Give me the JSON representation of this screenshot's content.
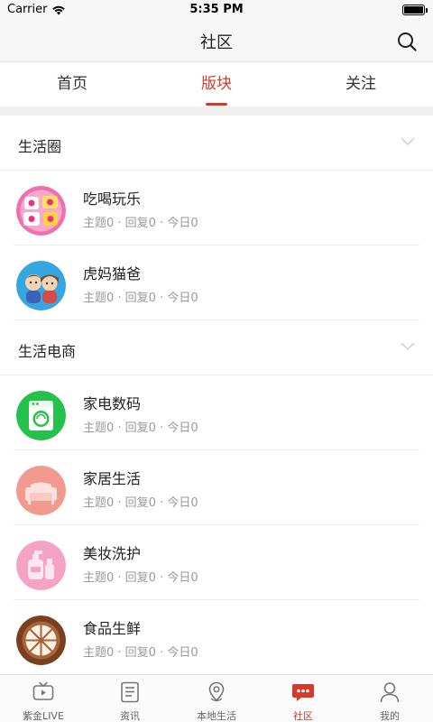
{
  "status_bar": {
    "carrier": "Carrier",
    "time": "5:35 PM"
  },
  "nav": {
    "title": "社区"
  },
  "tabs": [
    {
      "label": "首页"
    },
    {
      "label": "版块"
    },
    {
      "label": "关注"
    }
  ],
  "sections": [
    {
      "title": "生活圈",
      "forums": [
        {
          "name": "吃喝玩乐",
          "stats": "主题0 · 回复0 · 今日0",
          "icon": "eat-drink-play-icon"
        },
        {
          "name": "虎妈猫爸",
          "stats": "主题0 · 回复0 · 今日0",
          "icon": "parents-icon"
        }
      ]
    },
    {
      "title": "生活电商",
      "forums": [
        {
          "name": "家电数码",
          "stats": "主题0 · 回复0 · 今日0",
          "icon": "washing-machine-icon"
        },
        {
          "name": "家居生活",
          "stats": "主题0 · 回复0 · 今日0",
          "icon": "sofa-icon"
        },
        {
          "name": "美妆洗护",
          "stats": "主题0 · 回复0 · 今日0",
          "icon": "cosmetics-icon"
        },
        {
          "name": "食品生鲜",
          "stats": "主题0 · 回复0 · 今日0",
          "icon": "fruit-icon"
        }
      ]
    }
  ],
  "bottom_tabs": [
    {
      "label": "紫金LIVE",
      "icon": "tv-icon"
    },
    {
      "label": "资讯",
      "icon": "news-icon"
    },
    {
      "label": "本地生活",
      "icon": "location-pin-icon"
    },
    {
      "label": "社区",
      "icon": "chat-bubble-icon"
    },
    {
      "label": "我的",
      "icon": "user-icon"
    }
  ],
  "colors": {
    "accent": "#d33a2c",
    "text": "#222222",
    "muted": "#9a9a9a"
  }
}
